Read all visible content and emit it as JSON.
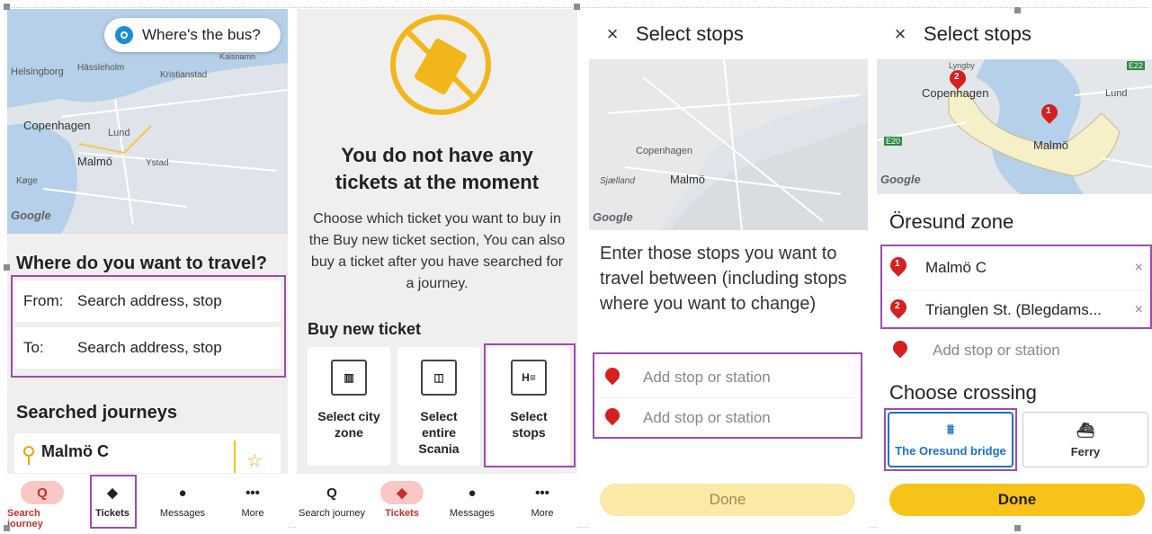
{
  "panel1": {
    "where_bus": "Where's the bus?",
    "map_labels": [
      "Helsingborg",
      "Hässleholm",
      "Kristianstad",
      "Kaisnamn",
      "Copenhagen",
      "Lund",
      "Malmö",
      "Ystad",
      "Køge"
    ],
    "google": "Google",
    "question": "Where do you want to travel?",
    "from_label": "From:",
    "from_placeholder": "Search address, stop",
    "to_label": "To:",
    "to_placeholder": "Search address, stop",
    "searched_title": "Searched journeys",
    "journey": "Malmö C",
    "nav": [
      {
        "label": "Search journey",
        "icon": "Q"
      },
      {
        "label": "Tickets",
        "icon": "◆"
      },
      {
        "label": "Messages",
        "icon": "●"
      },
      {
        "label": "More",
        "icon": "•••"
      }
    ]
  },
  "panel2": {
    "title": "You do not have any tickets at the moment",
    "desc": "Choose which ticket you want to buy in the Buy new ticket section, You can also buy a ticket after you have searched for a journey.",
    "buy_title": "Buy new ticket",
    "cards": [
      "Select city zone",
      "Select entire Scania",
      "Select stops"
    ],
    "nav": [
      {
        "label": "Search journey",
        "icon": "Q"
      },
      {
        "label": "Tickets",
        "icon": "◆"
      },
      {
        "label": "Messages",
        "icon": "●"
      },
      {
        "label": "More",
        "icon": "•••"
      }
    ]
  },
  "panel3": {
    "close": "×",
    "title": "Select stops",
    "map_labels": [
      "Copenhagen",
      "Sjælland",
      "Malmö"
    ],
    "google": "Google",
    "instructions": "Enter those stops you want to travel between (including stops where you want to change)",
    "stop1_placeholder": "Add stop or station",
    "stop2_placeholder": "Add stop or station",
    "done": "Done"
  },
  "panel4": {
    "close": "×",
    "title": "Select stops",
    "map_labels": [
      "Lyngby",
      "Copenhagen",
      "Lund",
      "Malmö",
      "E20",
      "E22"
    ],
    "google": "Google",
    "zone_title": "Öresund zone",
    "stop1": "Malmö C",
    "stop2": "Trianglen St. (Blegdams...",
    "clear": "×",
    "add_stop": "Add stop or station",
    "crossing_title": "Choose crossing",
    "crossing1": "The Oresund bridge",
    "crossing2": "Ferry",
    "done": "Done"
  },
  "colors": {
    "accent_red": "#c2322b",
    "highlight": "#9c4dad",
    "ticket_yellow": "#f3b61a",
    "done_yellow": "#f7c21a",
    "bridge_blue": "#1a73c9"
  }
}
